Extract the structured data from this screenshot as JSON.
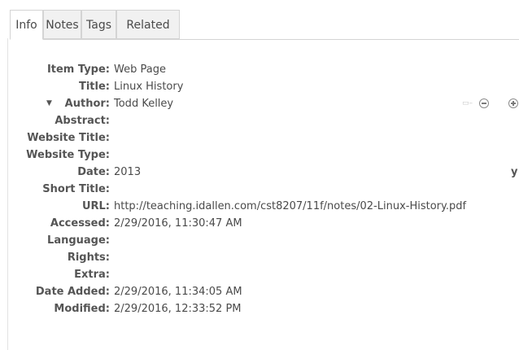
{
  "tabs": [
    {
      "label": "Info"
    },
    {
      "label": "Notes"
    },
    {
      "label": "Tags"
    },
    {
      "label": "Related"
    }
  ],
  "active_tab": "Info",
  "fields": [
    {
      "label": "Item Type:",
      "value": "Web Page"
    },
    {
      "label": "Title:",
      "value": "Linux History"
    },
    {
      "label": "Author:",
      "value": "Todd Kelley"
    },
    {
      "label": "Abstract:",
      "value": ""
    },
    {
      "label": "Website Title:",
      "value": ""
    },
    {
      "label": "Website Type:",
      "value": ""
    },
    {
      "label": "Date:",
      "value": "2013"
    },
    {
      "label": "Short Title:",
      "value": ""
    },
    {
      "label": "URL:",
      "value": "http://teaching.idallen.com/cst8207/11f/notes/02-Linux-History.pdf"
    },
    {
      "label": "Accessed:",
      "value": "2/29/2016, 11:30:47 AM"
    },
    {
      "label": "Language:",
      "value": ""
    },
    {
      "label": "Rights:",
      "value": ""
    },
    {
      "label": "Extra:",
      "value": ""
    },
    {
      "label": "Date Added:",
      "value": "2/29/2016, 11:34:05 AM"
    },
    {
      "label": "Modified:",
      "value": "2/29/2016, 12:33:52 PM"
    }
  ],
  "date_edge_char": "y",
  "icons": {
    "author_twisty": "triangle-down-icon",
    "creator_switch": "name-format-switch-icon",
    "remove_creator": "minus-circle-icon",
    "add_creator": "plus-circle-icon"
  }
}
